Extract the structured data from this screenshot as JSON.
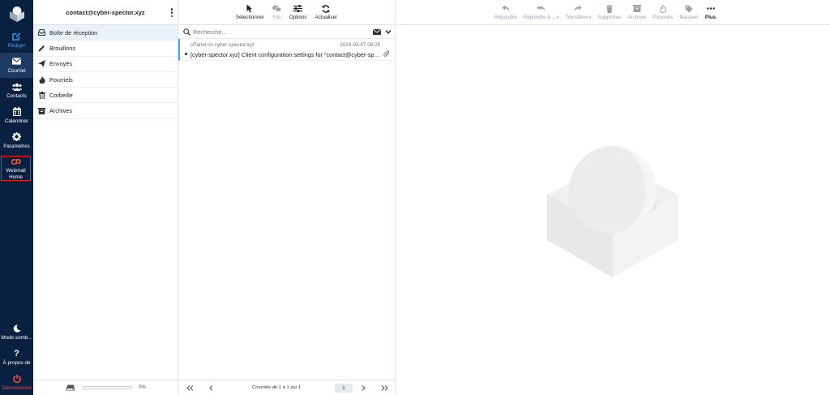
{
  "account": {
    "email": "contact@cyber-spector.xyz"
  },
  "nav": {
    "top": [
      {
        "label": "Rédiger",
        "icon": "compose-icon"
      },
      {
        "label": "Courriel",
        "icon": "envelope-icon"
      },
      {
        "label": "Contacts",
        "icon": "contacts-icon"
      },
      {
        "label": "Calendrier",
        "icon": "calendar-icon"
      },
      {
        "label": "Paramètres",
        "icon": "gear-icon"
      },
      {
        "label_line1": "Webmail",
        "label_line2": "Home",
        "icon": "cpanel-icon"
      }
    ],
    "bottom": [
      {
        "label": "Mode somb...",
        "icon": "moon-icon"
      },
      {
        "label": "À propos de",
        "icon": "question-icon"
      },
      {
        "label": "Déconnexion",
        "icon": "power-icon"
      }
    ]
  },
  "folders": [
    {
      "label": "Boîte de réception",
      "icon": "inbox-icon"
    },
    {
      "label": "Brouillons",
      "icon": "pencil-icon"
    },
    {
      "label": "Envoyés",
      "icon": "paper-plane-icon"
    },
    {
      "label": "Pourriels",
      "icon": "fire-icon"
    },
    {
      "label": "Corbeille",
      "icon": "trash-icon"
    },
    {
      "label": "Archives",
      "icon": "archive-box-icon"
    }
  ],
  "quota": {
    "percent_label": "0%",
    "fraction": 0
  },
  "list_toolbar": [
    {
      "label": "Sélectionner",
      "icon": "pointer-icon",
      "enabled": true
    },
    {
      "label": "Fils",
      "icon": "threads-icon",
      "enabled": false
    },
    {
      "label": "Options",
      "icon": "sliders-icon",
      "enabled": true
    },
    {
      "label": "Actualiser",
      "icon": "refresh-icon",
      "enabled": true
    }
  ],
  "search": {
    "placeholder": "Recherche..."
  },
  "messages": [
    {
      "from": "cPanel on cyber-spector.xyz",
      "date": "2024-03-07 08:29",
      "subject": "[cyber-spector.xyz] Client configuration settings for “contact@cyber-spector.xyz”",
      "has_attachment": true,
      "unread": true
    }
  ],
  "pager": {
    "text": "Courriels de 1 à 1 sur 1",
    "page": "1"
  },
  "reader_toolbar": [
    {
      "label": "Répondre",
      "icon": "reply-icon",
      "enabled": false
    },
    {
      "label": "Répondre à ...",
      "icon": "reply-all-icon",
      "enabled": false,
      "dropdown": true
    },
    {
      "label": "Transférer",
      "icon": "forward-icon",
      "enabled": false,
      "dropdown": true
    },
    {
      "label": "Supprimer",
      "icon": "trash-icon",
      "enabled": false
    },
    {
      "label": "Archiver",
      "icon": "archive-icon",
      "enabled": false
    },
    {
      "label": "Pourriels",
      "icon": "fire-icon",
      "enabled": false
    },
    {
      "label": "Marquer",
      "icon": "tag-icon",
      "enabled": false
    },
    {
      "label": "Plus",
      "icon": "more-dots-icon",
      "enabled": true
    }
  ],
  "colors": {
    "rail_bg": "#0a2040",
    "accent": "#3fa3ff",
    "danger": "#e3262a"
  }
}
